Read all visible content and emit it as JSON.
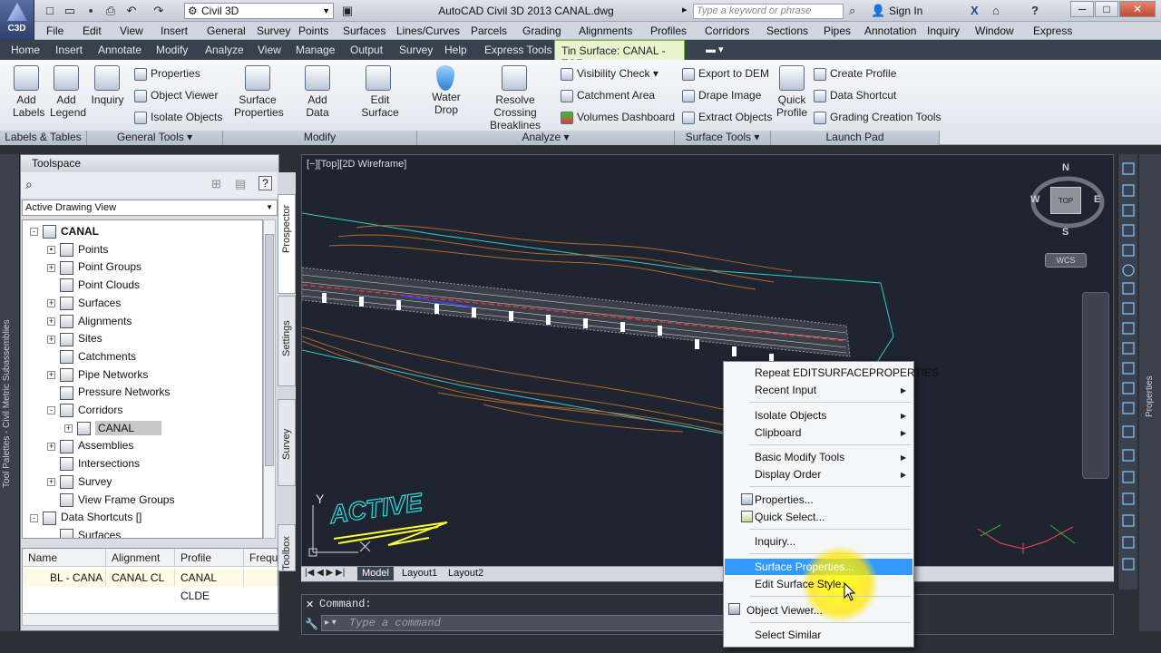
{
  "title_bar": {
    "app_menu_label": "C3D",
    "workspace": "Civil 3D",
    "title": "AutoCAD Civil 3D 2013    CANAL.dwg",
    "search_placeholder": "Type a keyword or phrase",
    "sign_in": "Sign In"
  },
  "menubar": [
    "File",
    "Edit",
    "View",
    "Insert",
    "General",
    "Survey",
    "Points",
    "Surfaces",
    "Lines/Curves",
    "Parcels",
    "Grading",
    "Alignments",
    "Profiles",
    "Corridors",
    "Sections",
    "Pipes",
    "Annotation",
    "Inquiry",
    "Window",
    "Express"
  ],
  "ribbon_tabs": [
    "Home",
    "Insert",
    "Annotate",
    "Modify",
    "Analyze",
    "View",
    "Manage",
    "Output",
    "Survey",
    "Help",
    "Express Tools"
  ],
  "contextual_tab": "Tin Surface: CANAL - TOP",
  "ribbon": {
    "labels_tables": {
      "add_labels": "Add Labels",
      "add_legend": "Add Legend",
      "footer": "Labels & Tables"
    },
    "general_tools": {
      "inquiry": "Inquiry",
      "properties": "Properties",
      "object_viewer": "Object Viewer",
      "isolate_objects": "Isolate Objects",
      "footer": "General Tools"
    },
    "modify": {
      "surface_properties": "Surface Properties",
      "add_data": "Add Data",
      "edit_surface": "Edit Surface",
      "footer": "Modify"
    },
    "analyze": {
      "water_drop": "Water Drop",
      "resolve_crossing": "Resolve Crossing Breaklines",
      "visibility_check": "Visibility Check",
      "catchment_area": "Catchment Area",
      "volumes_dashboard": "Volumes Dashboard",
      "footer": "Analyze"
    },
    "surface_tools": {
      "export_dem": "Export to DEM",
      "drape_image": "Drape Image",
      "extract_objects": "Extract Objects",
      "footer": "Surface Tools"
    },
    "launch_pad": {
      "quick_profile": "Quick Profile",
      "create_profile": "Create Profile",
      "data_shortcut": "Data Shortcut",
      "grading_creation_tools": "Grading Creation Tools",
      "footer": "Launch Pad"
    }
  },
  "toolspace": {
    "title": "Toolspace",
    "view": "Active Drawing View",
    "tree": [
      {
        "label": "CANAL",
        "level": 0,
        "toggle": "-",
        "bold": true
      },
      {
        "label": "Points",
        "level": 1,
        "toggle": "•"
      },
      {
        "label": "Point Groups",
        "level": 1,
        "toggle": "+"
      },
      {
        "label": "Point Clouds",
        "level": 1,
        "toggle": ""
      },
      {
        "label": "Surfaces",
        "level": 1,
        "toggle": "+"
      },
      {
        "label": "Alignments",
        "level": 1,
        "toggle": "+"
      },
      {
        "label": "Sites",
        "level": 1,
        "toggle": "+"
      },
      {
        "label": "Catchments",
        "level": 1,
        "toggle": ""
      },
      {
        "label": "Pipe Networks",
        "level": 1,
        "toggle": "+"
      },
      {
        "label": "Pressure Networks",
        "level": 1,
        "toggle": ""
      },
      {
        "label": "Corridors",
        "level": 1,
        "toggle": "-"
      },
      {
        "label": "CANAL",
        "level": 2,
        "toggle": "+",
        "selected": true
      },
      {
        "label": "Assemblies",
        "level": 1,
        "toggle": "+"
      },
      {
        "label": "Intersections",
        "level": 1,
        "toggle": ""
      },
      {
        "label": "Survey",
        "level": 1,
        "toggle": "+"
      },
      {
        "label": "View Frame Groups",
        "level": 1,
        "toggle": ""
      },
      {
        "label": "Data Shortcuts []",
        "level": 0,
        "toggle": "-"
      },
      {
        "label": "Surfaces",
        "level": 1,
        "toggle": ""
      }
    ],
    "side_tabs": [
      "Prospector",
      "Settings",
      "Survey",
      "Toolbox"
    ],
    "grid_headers": [
      "Name",
      "Alignment",
      "Profile",
      "Frequ"
    ],
    "grid_row": [
      "BL - CANA",
      "CANAL CL",
      "CANAL CLDE",
      ""
    ],
    "palette_label": "Tool Palettes - Civil Metric Subassemblies"
  },
  "viewport": {
    "label": "[−][Top][2D Wireframe]",
    "compass": {
      "n": "N",
      "s": "S",
      "e": "E",
      "w": "W"
    },
    "cube_face": "TOP",
    "wcs": "WCS",
    "active_text": "ACTIVE",
    "layout_tabs": [
      "Model",
      "Layout1",
      "Layout2"
    ]
  },
  "command": {
    "label": "Command:",
    "placeholder": "Type a command"
  },
  "properties_label": "Properties",
  "context_menu": {
    "items": [
      {
        "label": "Repeat EDITSURFACEPROPERTIES",
        "submenu": false
      },
      {
        "label": "Recent Input",
        "submenu": true
      },
      {
        "label": "Isolate Objects",
        "submenu": true
      },
      {
        "label": "Clipboard",
        "submenu": true
      },
      {
        "label": "Basic Modify Tools",
        "submenu": true
      },
      {
        "label": "Display Order",
        "submenu": true
      },
      {
        "label": "Properties...",
        "submenu": false
      },
      {
        "label": "Quick Select...",
        "submenu": false
      },
      {
        "label": "Inquiry...",
        "submenu": false
      },
      {
        "label": "Surface Properties...",
        "submenu": false,
        "highlighted": true
      },
      {
        "label": "Edit Surface Style...",
        "submenu": false
      },
      {
        "label": "Object Viewer...",
        "submenu": false
      },
      {
        "label": "Select Similar",
        "submenu": false
      }
    ]
  },
  "colors": {
    "accent": "#3399ff",
    "drawing_bg": "#1e2430",
    "context_tab": "#e8f4d0",
    "boundary": "#33cccc",
    "centerline": "#ff3333"
  }
}
